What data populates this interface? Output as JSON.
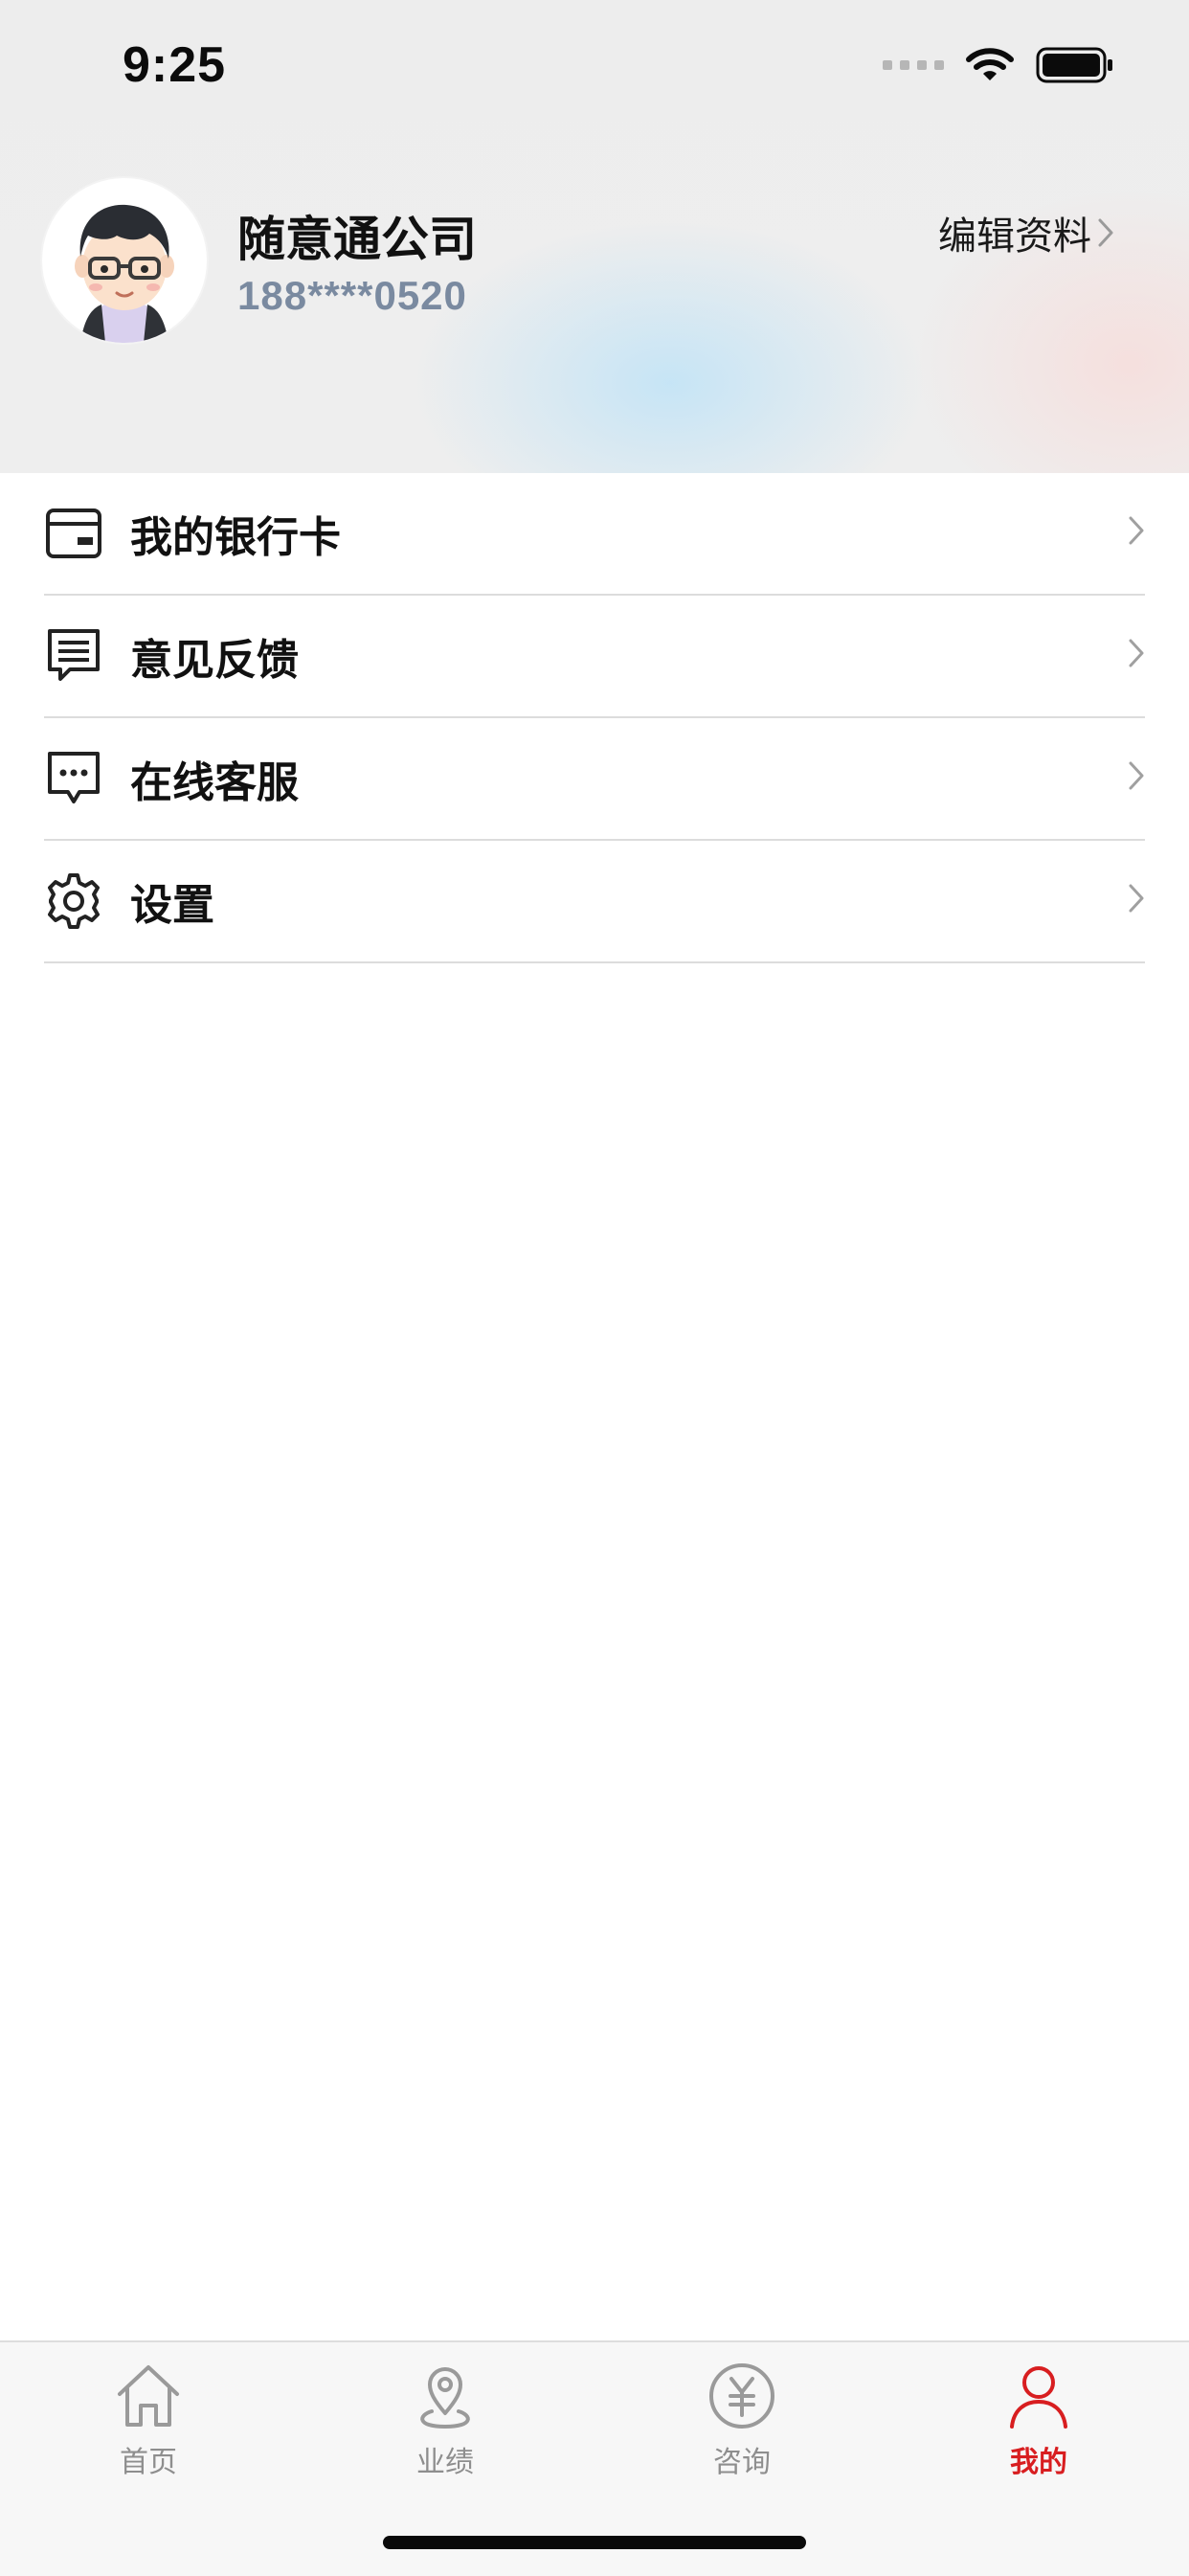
{
  "status_bar": {
    "time": "9:25"
  },
  "profile": {
    "name": "随意通公司",
    "phone": "188****0520",
    "edit_label": "编辑资料"
  },
  "menu": {
    "items": [
      {
        "label": "我的银行卡",
        "icon": "bank-card-icon"
      },
      {
        "label": "意见反馈",
        "icon": "feedback-icon"
      },
      {
        "label": "在线客服",
        "icon": "chat-bubble-icon"
      },
      {
        "label": "设置",
        "icon": "gear-icon"
      }
    ]
  },
  "tabbar": {
    "tabs": [
      {
        "label": "首页",
        "icon": "home-icon",
        "active": false
      },
      {
        "label": "业绩",
        "icon": "location-pin-icon",
        "active": false
      },
      {
        "label": "咨询",
        "icon": "yuan-coin-icon",
        "active": false
      },
      {
        "label": "我的",
        "icon": "person-icon",
        "active": true
      }
    ]
  },
  "colors": {
    "accent": "#d81e20",
    "inactive": "#8e8e8e",
    "phone": "#7a8aa0"
  }
}
